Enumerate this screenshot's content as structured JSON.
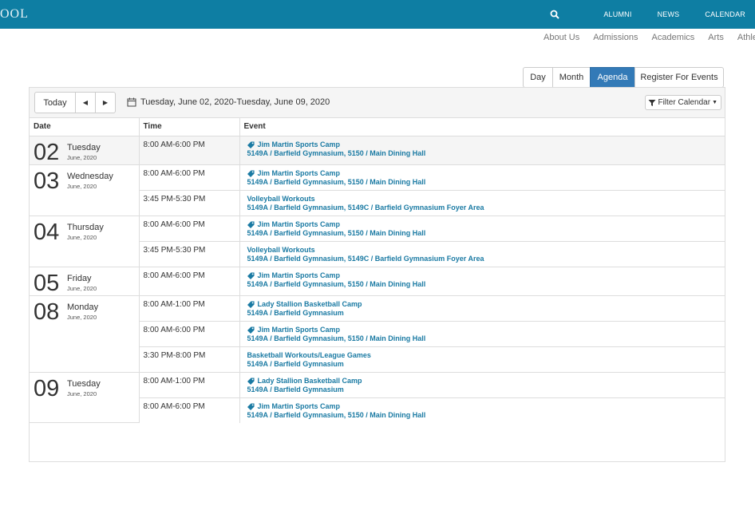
{
  "header": {
    "logo": "OOL",
    "nav": [
      "ALUMNI",
      "NEWS",
      "CALENDAR"
    ],
    "colors": {
      "bar": "#0e7ea3",
      "link": "#1a7aa3",
      "active": "#337ab7"
    }
  },
  "subnav": [
    "About Us",
    "Admissions",
    "Academics",
    "Arts",
    "Athlet"
  ],
  "views": {
    "day": "Day",
    "month": "Month",
    "agenda": "Agenda",
    "register": "Register For Events",
    "active": "Agenda"
  },
  "toolbar": {
    "today": "Today",
    "prev": "◀",
    "next": "▶",
    "range": "Tuesday, June 02, 2020-Tuesday, June 09, 2020",
    "filter": "Filter Calendar"
  },
  "columns": {
    "date": "Date",
    "time": "Time",
    "event": "Event"
  },
  "days": [
    {
      "num": "02",
      "name": "Tuesday",
      "month": "June, 2020",
      "events": [
        {
          "time": "8:00 AM-6:00 PM",
          "title": "Jim Martin Sports Camp",
          "tag": true,
          "location": "5149A / Barfield Gymnasium, 5150 / Main Dining Hall"
        }
      ]
    },
    {
      "num": "03",
      "name": "Wednesday",
      "month": "June, 2020",
      "events": [
        {
          "time": "8:00 AM-6:00 PM",
          "title": "Jim Martin Sports Camp",
          "tag": true,
          "location": "5149A / Barfield Gymnasium, 5150 / Main Dining Hall"
        },
        {
          "time": "3:45 PM-5:30 PM",
          "title": "Volleyball Workouts",
          "tag": false,
          "location": "5149A / Barfield Gymnasium, 5149C / Barfield Gymnasium Foyer Area"
        }
      ]
    },
    {
      "num": "04",
      "name": "Thursday",
      "month": "June, 2020",
      "events": [
        {
          "time": "8:00 AM-6:00 PM",
          "title": "Jim Martin Sports Camp",
          "tag": true,
          "location": "5149A / Barfield Gymnasium, 5150 / Main Dining Hall"
        },
        {
          "time": "3:45 PM-5:30 PM",
          "title": "Volleyball Workouts",
          "tag": false,
          "location": "5149A / Barfield Gymnasium, 5149C / Barfield Gymnasium Foyer Area"
        }
      ]
    },
    {
      "num": "05",
      "name": "Friday",
      "month": "June, 2020",
      "events": [
        {
          "time": "8:00 AM-6:00 PM",
          "title": "Jim Martin Sports Camp",
          "tag": true,
          "location": "5149A / Barfield Gymnasium, 5150 / Main Dining Hall"
        }
      ]
    },
    {
      "num": "08",
      "name": "Monday",
      "month": "June, 2020",
      "events": [
        {
          "time": "8:00 AM-1:00 PM",
          "title": "Lady Stallion Basketball Camp",
          "tag": true,
          "location": "5149A / Barfield Gymnasium"
        },
        {
          "time": "8:00 AM-6:00 PM",
          "title": "Jim Martin Sports Camp",
          "tag": true,
          "location": "5149A / Barfield Gymnasium, 5150 / Main Dining Hall"
        },
        {
          "time": "3:30 PM-8:00 PM",
          "title": "Basketball Workouts/League Games",
          "tag": false,
          "location": "5149A / Barfield Gymnasium"
        }
      ]
    },
    {
      "num": "09",
      "name": "Tuesday",
      "month": "June, 2020",
      "events": [
        {
          "time": "8:00 AM-1:00 PM",
          "title": "Lady Stallion Basketball Camp",
          "tag": true,
          "location": "5149A / Barfield Gymnasium"
        },
        {
          "time": "8:00 AM-6:00 PM",
          "title": "Jim Martin Sports Camp",
          "tag": true,
          "location": "5149A / Barfield Gymnasium, 5150 / Main Dining Hall"
        }
      ]
    }
  ]
}
